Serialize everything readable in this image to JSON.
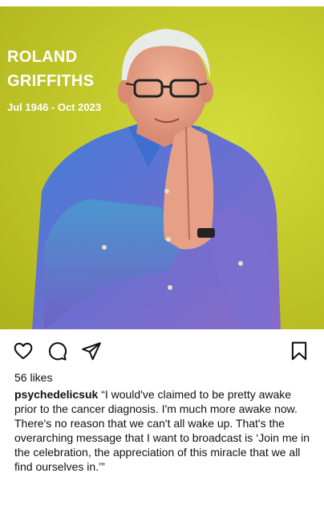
{
  "post": {
    "overlay": {
      "name_line1": "ROLAND",
      "name_line2": "GRIFFITHS",
      "dates": "Jul 1946 - Oct 2023"
    },
    "image_colors": {
      "background": "#c3c92b",
      "shirt": "#5a7fd6"
    }
  },
  "actions": {
    "icons": [
      "heart-icon",
      "comment-icon",
      "share-icon",
      "bookmark-icon"
    ]
  },
  "likes": "56 likes",
  "caption": {
    "username": "psychedelicsuk",
    "text": "“I would've claimed to be pretty awake prior to the cancer diagnosis. I'm much more awake now. There's no reason that we can't all wake up. That's the overarching message that I want to broadcast is ‘Join me in the celebration, the appreciation of this miracle that we all find ourselves in.’”"
  }
}
